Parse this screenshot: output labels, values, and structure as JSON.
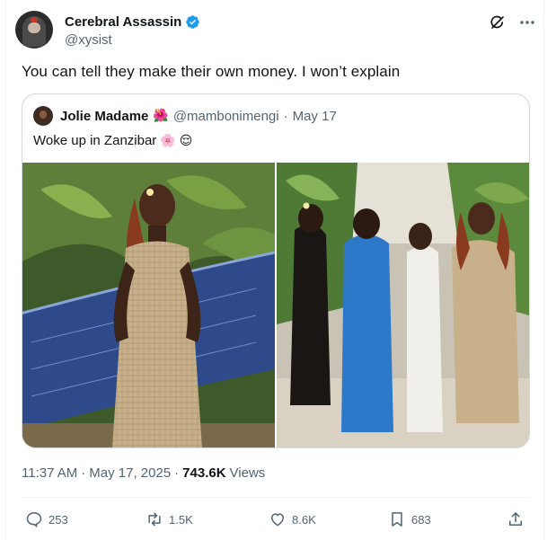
{
  "author": {
    "display_name": "Cerebral Assassin",
    "handle": "@xysist"
  },
  "tweet": {
    "text": "You can tell they make their own money. I won’t explain"
  },
  "quoted": {
    "display_name": "Jolie Madame",
    "name_emoji": "🌺",
    "handle": "@mambonimengi",
    "separator": "·",
    "date": "May 17",
    "text": "Woke up in Zanzibar",
    "text_emoji_1": "🌸",
    "text_emoji_2": "😌"
  },
  "meta": {
    "time": "11:37 AM",
    "separator1": "·",
    "date": "May 17, 2025",
    "separator2": "·",
    "views_count": "743.6K",
    "views_label": "Views"
  },
  "actions": {
    "replies": "253",
    "reposts": "1.5K",
    "likes": "8.6K",
    "bookmarks": "683"
  },
  "icons": {
    "verified": "verified-badge-icon",
    "grok": "grok-icon",
    "more": "more-icon",
    "reply": "reply-icon",
    "repost": "repost-icon",
    "like": "like-icon",
    "bookmark": "bookmark-icon",
    "share": "share-icon"
  },
  "colors": {
    "text_primary": "#0f1419",
    "text_secondary": "#536471",
    "verified_blue": "#1d9bf0",
    "border": "#cfd9de"
  }
}
